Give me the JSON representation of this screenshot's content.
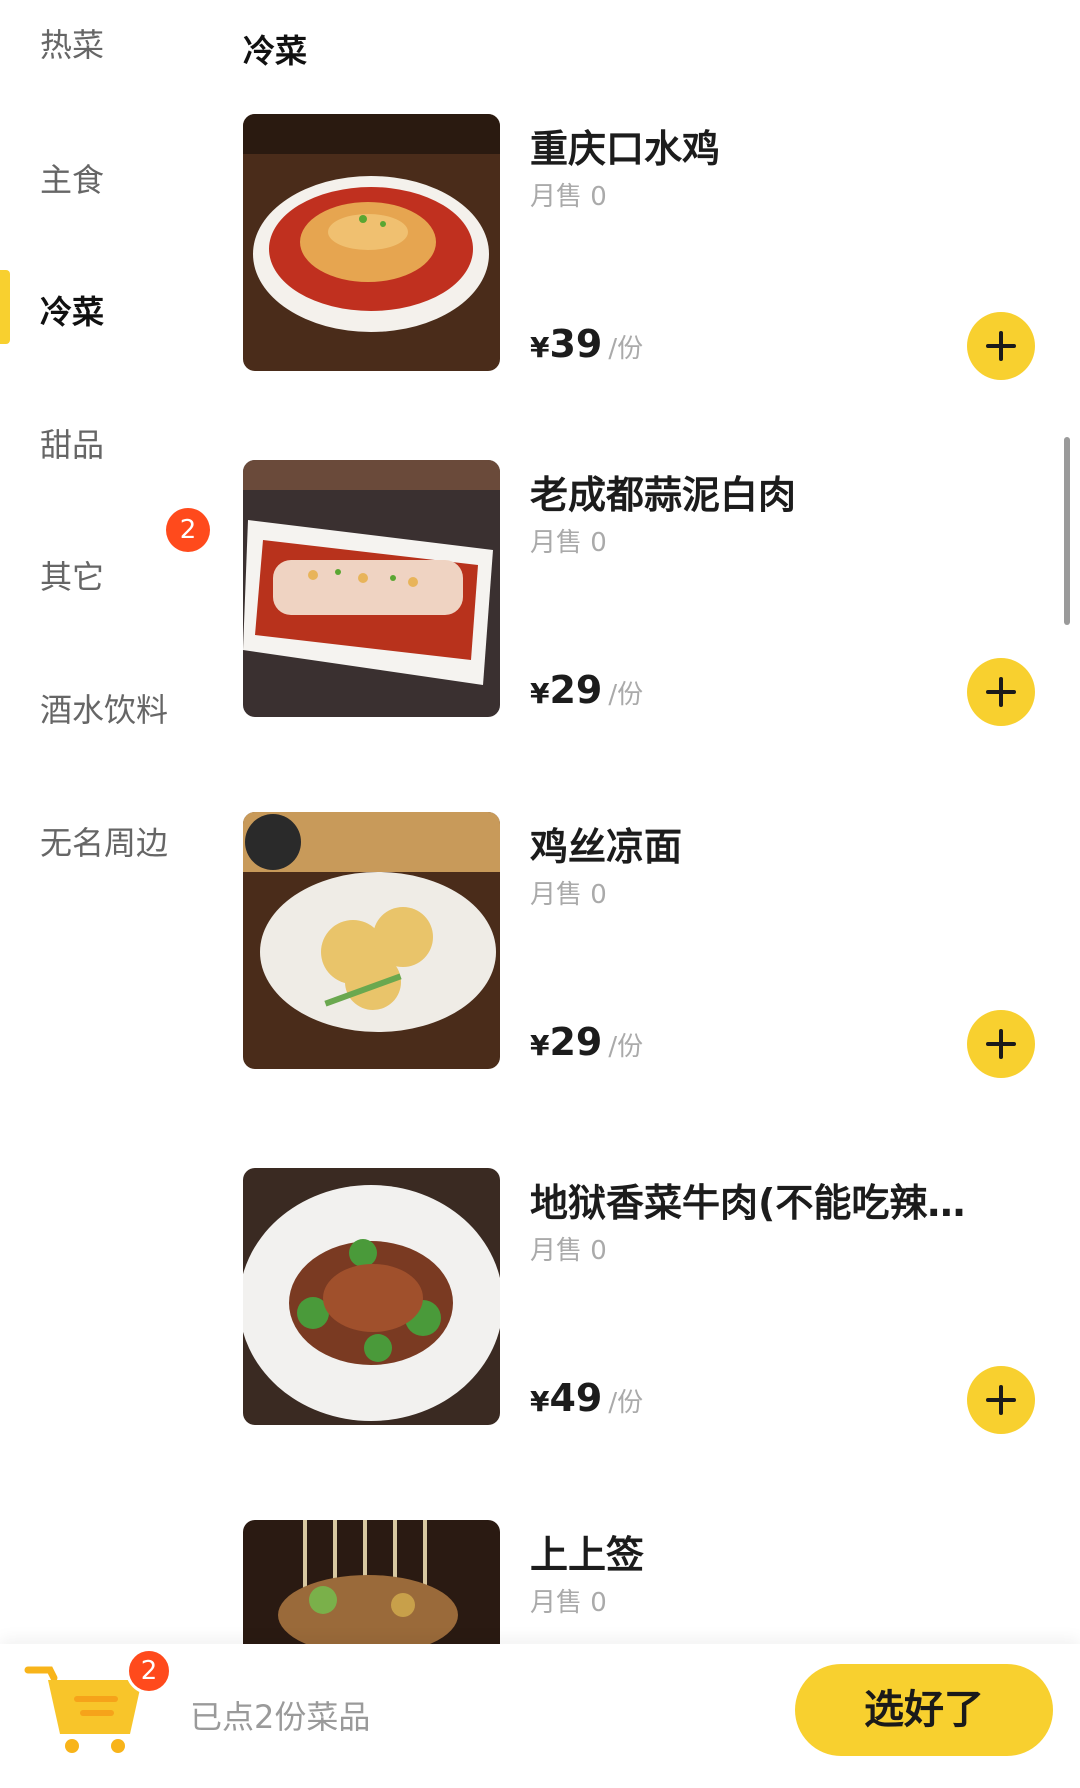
{
  "sidebar": {
    "categories": [
      {
        "label": "热菜"
      },
      {
        "label": "主食"
      },
      {
        "label": "冷菜"
      },
      {
        "label": "甜品"
      },
      {
        "label": "其它"
      },
      {
        "label": "酒水饮料"
      },
      {
        "label": "无名周边"
      }
    ],
    "active_category": "冷菜",
    "badge_count": "2"
  },
  "section_title": "冷菜",
  "items": [
    {
      "name": "重庆口水鸡",
      "sales": "月售 0",
      "currency": "¥",
      "price": "39",
      "unit": "/份"
    },
    {
      "name": "老成都蒜泥白肉",
      "sales": "月售 0",
      "currency": "¥",
      "price": "29",
      "unit": "/份"
    },
    {
      "name": "鸡丝凉面",
      "sales": "月售 0",
      "currency": "¥",
      "price": "29",
      "unit": "/份"
    },
    {
      "name": "地狱香菜牛肉(不能吃辣…",
      "sales": "月售 0",
      "currency": "¥",
      "price": "49",
      "unit": "/份"
    },
    {
      "name": "上上签",
      "sales": "月售 0"
    }
  ],
  "cart": {
    "count": "2",
    "summary": "已点2份菜品",
    "checkout_label": "选好了"
  },
  "colors": {
    "accent": "#f8d02f",
    "badge": "#ff4a1c"
  }
}
